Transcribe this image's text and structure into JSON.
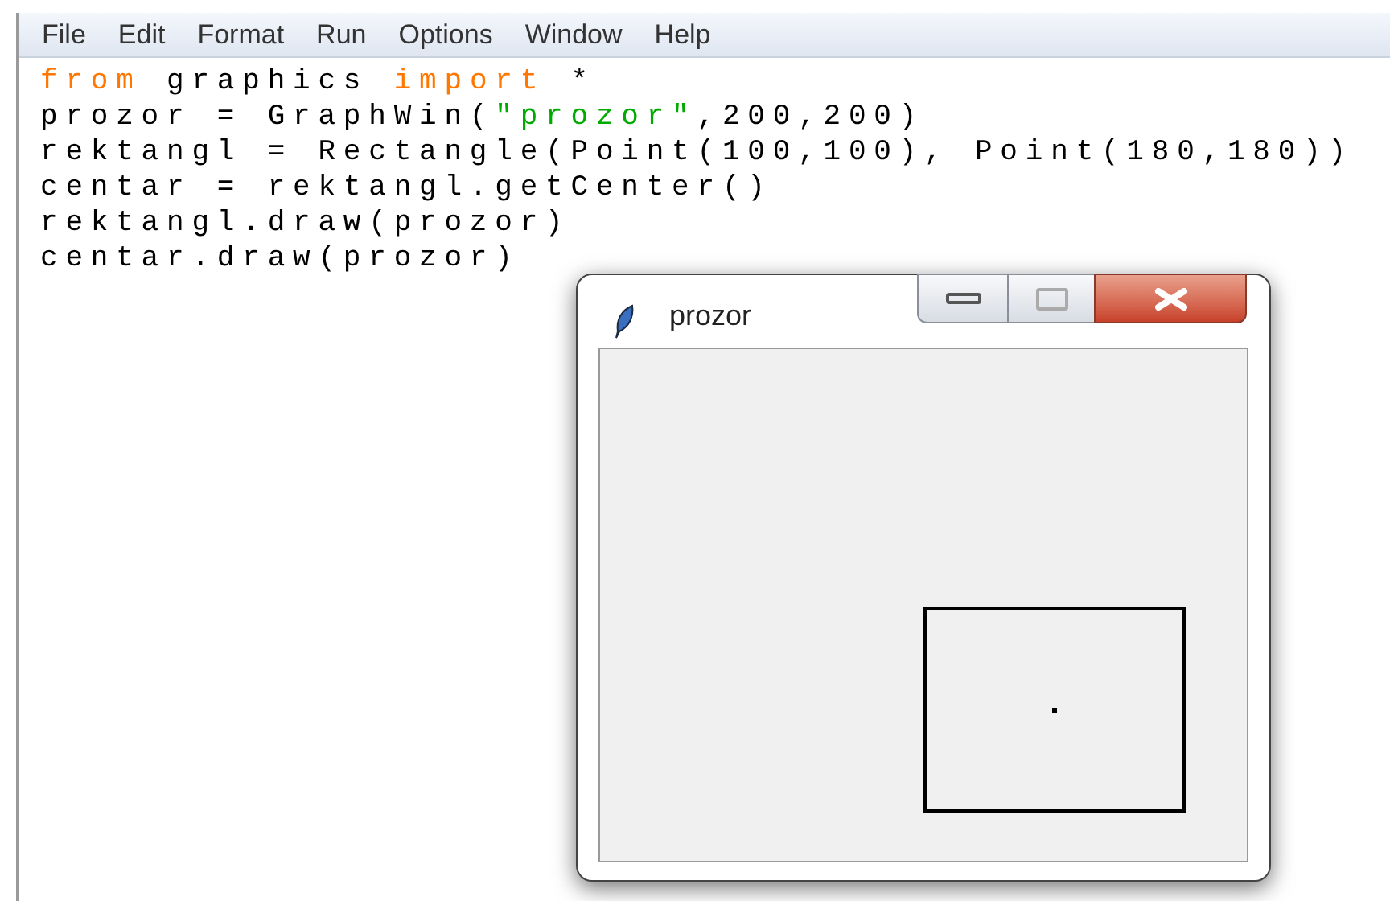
{
  "menu": [
    "File",
    "Edit",
    "Format",
    "Run",
    "Options",
    "Window",
    "Help"
  ],
  "editor": {
    "lines": [
      [
        {
          "text": "from",
          "kind": "keyword"
        },
        {
          "text": " graphics ",
          "kind": "plain"
        },
        {
          "text": "import",
          "kind": "keyword"
        },
        {
          "text": " *",
          "kind": "plain"
        }
      ],
      [
        {
          "text": "prozor = GraphWin(",
          "kind": "plain"
        },
        {
          "text": "\"prozor\"",
          "kind": "string"
        },
        {
          "text": ",200,200)",
          "kind": "plain"
        }
      ],
      [
        {
          "text": "rektangl = Rectangle(Point(100,100), Point(180,180))",
          "kind": "plain"
        }
      ],
      [
        {
          "text": "centar = rektangl.getCenter()",
          "kind": "plain"
        }
      ],
      [
        {
          "text": "rektangl.draw(prozor)",
          "kind": "plain"
        }
      ],
      [
        {
          "text": "centar.draw(prozor)",
          "kind": "plain"
        }
      ]
    ]
  },
  "graph_window": {
    "title": "prozor"
  }
}
